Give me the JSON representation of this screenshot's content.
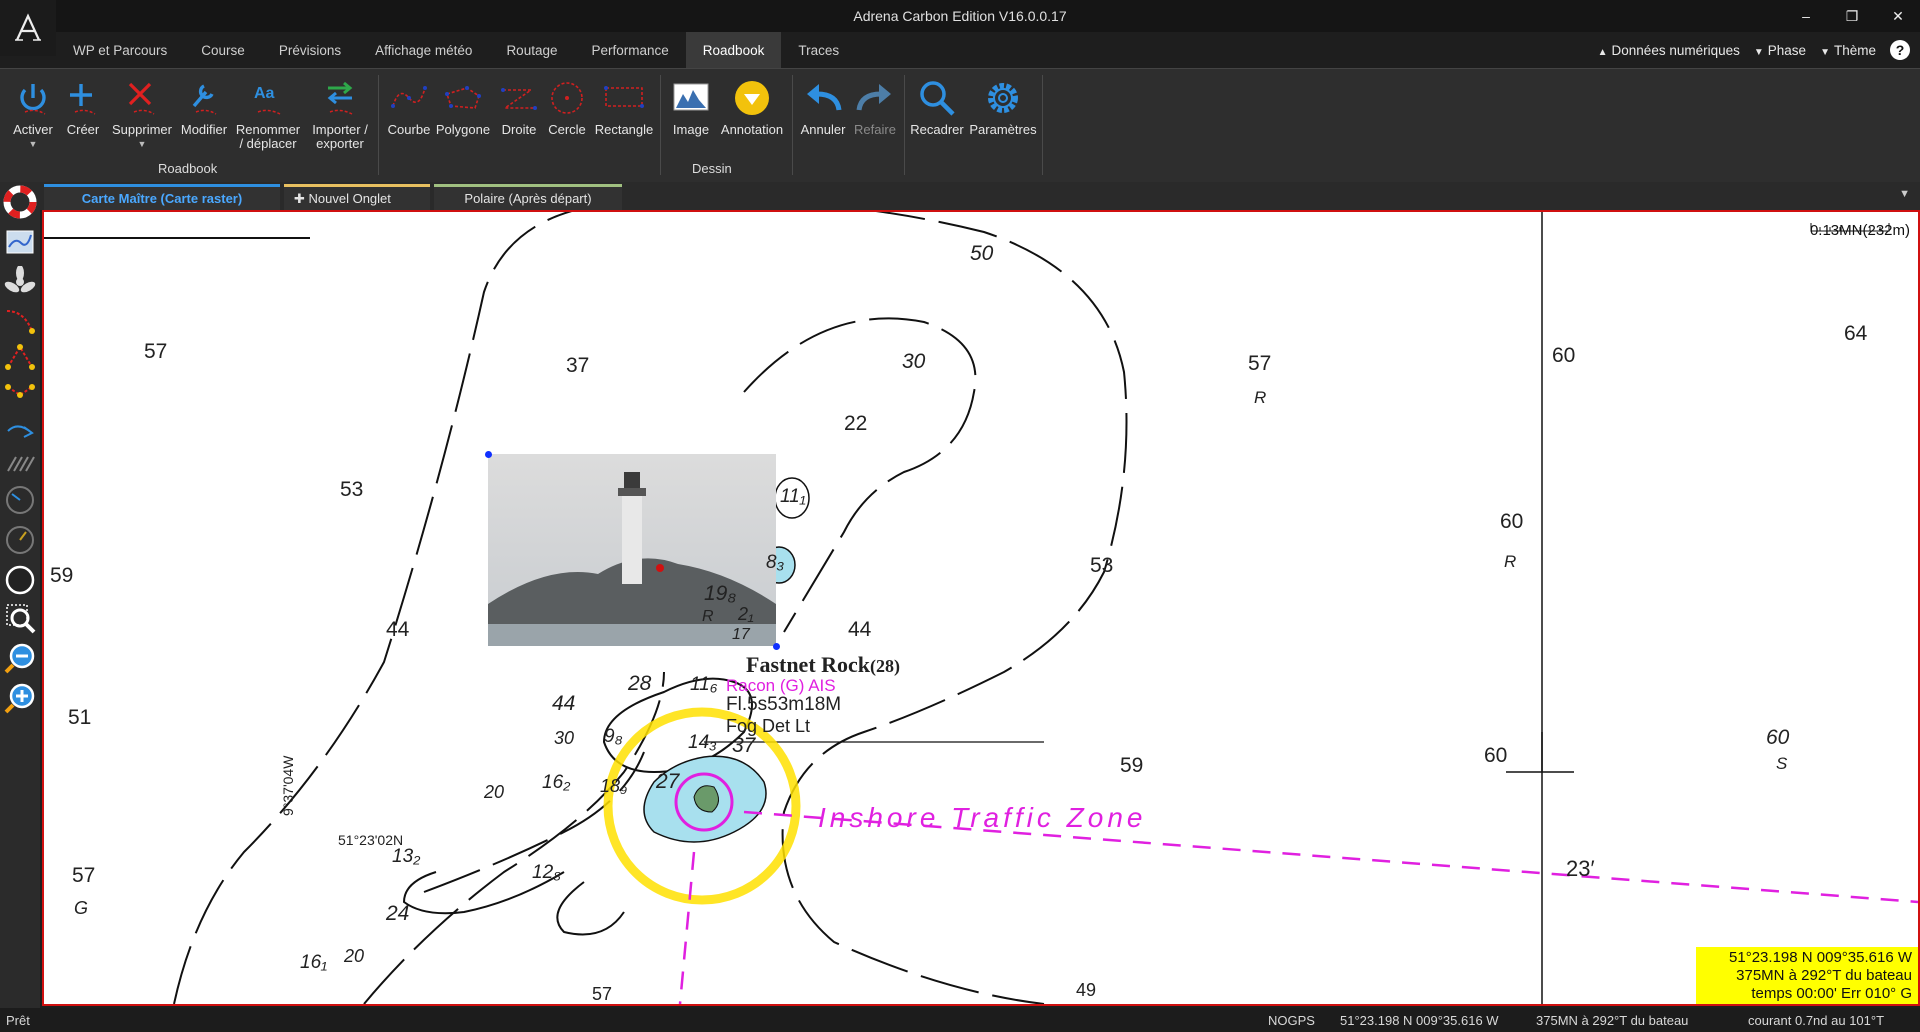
{
  "app": {
    "title": "Adrena Carbon Edition V16.0.0.17"
  },
  "window_controls": {
    "minimize": "–",
    "restore": "❐",
    "close": "✕"
  },
  "menu_tabs": [
    {
      "label": "WP et Parcours"
    },
    {
      "label": "Course"
    },
    {
      "label": "Prévisions"
    },
    {
      "label": "Affichage météo"
    },
    {
      "label": "Routage"
    },
    {
      "label": "Performance"
    },
    {
      "label": "Roadbook"
    },
    {
      "label": "Traces"
    }
  ],
  "active_tab": "Roadbook",
  "top_right": {
    "numeric_data": "Données numériques",
    "phase": "Phase",
    "theme": "Thème",
    "help": "?"
  },
  "ribbon": {
    "roadbook_group": "Roadbook",
    "drawing_group": "Dessin",
    "buttons": {
      "activer": "Activer",
      "creer": "Créer",
      "supprimer": "Supprimer",
      "modifier": "Modifier",
      "renommer_1": "Renommer",
      "renommer_2": "/ déplacer",
      "importer_1": "Importer /",
      "importer_2": "exporter",
      "courbe": "Courbe",
      "polygone": "Polygone",
      "droite": "Droite",
      "cercle": "Cercle",
      "rectangle": "Rectangle",
      "image": "Image",
      "annotation": "Annotation",
      "annuler": "Annuler",
      "refaire": "Refaire",
      "recadrer": "Recadrer",
      "parametres": "Paramètres"
    }
  },
  "chart_tabs": {
    "master": "Carte Maître (Carte raster)",
    "new_tab": "Nouvel Onglet",
    "polar": "Polaire (Après départ)"
  },
  "map": {
    "scale": "0.13MN(232m)",
    "depths": [
      "57",
      "37",
      "50",
      "30",
      "22",
      "57",
      "60",
      "64",
      "53",
      "11₁",
      "60",
      "8₃",
      "53",
      "R",
      "R",
      "59",
      "19₈",
      "2₁",
      "R",
      "17",
      "44",
      "44",
      "28",
      "11₆",
      "44",
      "9₈",
      "30",
      "14₃",
      "37",
      "16₂",
      "18₉",
      "27",
      "51",
      "20",
      "59",
      "60",
      "60",
      "S",
      "R",
      "13₂",
      "12₈",
      "24",
      "57",
      "G",
      "16₁",
      "20",
      "57",
      "49"
    ],
    "labels": {
      "rock": "Fastnet Rock",
      "rock_depth": "(28)",
      "racon": "Racon (G) AIS",
      "light": "Fl.5s53m18M",
      "fog": "Fog Det Lt",
      "zone": "Inshore Traffic Zone",
      "lon": "9°37'04W",
      "lat": "51°23'02N",
      "minute": "23′"
    },
    "info": {
      "line1": "51°23.198 N  009°35.616 W",
      "line2": "375MN à 292°T du bateau",
      "line3": "temps 00:00' Err 010° G"
    }
  },
  "status": {
    "ready": "Prêt",
    "gps": "NOGPS",
    "position": "51°23.198 N  009°35.616 W",
    "bearing": "375MN à 292°T du bateau",
    "current": "courant 0.7nd au 101°T"
  },
  "colors": {
    "accent": "#2e8fe0",
    "map_border": "#d01010",
    "info_bg": "#ffff00",
    "magenta": "#e020e0"
  }
}
